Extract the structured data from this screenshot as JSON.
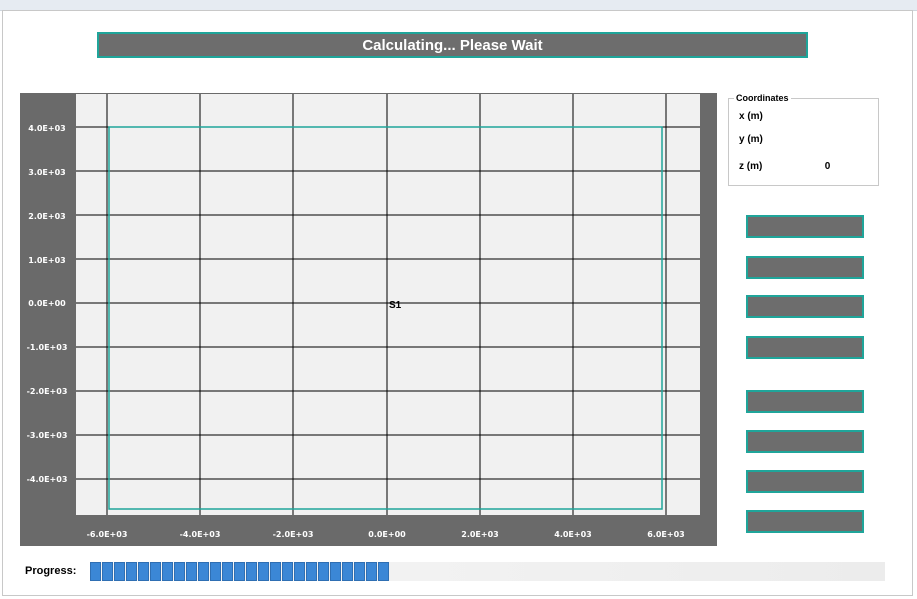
{
  "status": {
    "message": "Calculating... Please Wait"
  },
  "plot": {
    "y_ticks": [
      "4.0E+03",
      "3.0E+03",
      "2.0E+03",
      "1.0E+03",
      "0.0E+00",
      "-1.0E+03",
      "-2.0E+03",
      "-3.0E+03",
      "-4.0E+03"
    ],
    "x_ticks": [
      "-6.0E+03",
      "-4.0E+03",
      "-2.0E+03",
      "0.0E+00",
      "2.0E+03",
      "4.0E+03",
      "6.0E+03"
    ],
    "marker_label": "S1",
    "colors": {
      "panel": "#6a6a6a",
      "area": "#f1f1f1",
      "grid": "#000000",
      "boundary": "#1fa59a"
    }
  },
  "coordinates": {
    "legend": "Coordinates",
    "x_label": "x (m)",
    "y_label": "y (m)",
    "z_label": "z (m)",
    "x_value": "",
    "y_value": "",
    "z_value": "0"
  },
  "side_buttons": [
    "",
    "",
    "",
    "",
    "",
    "",
    "",
    ""
  ],
  "progress": {
    "label": "Progress:",
    "segments_filled": 25,
    "fraction": 0.45,
    "color": "#3b87d6"
  },
  "accent_color": "#1fa59a"
}
